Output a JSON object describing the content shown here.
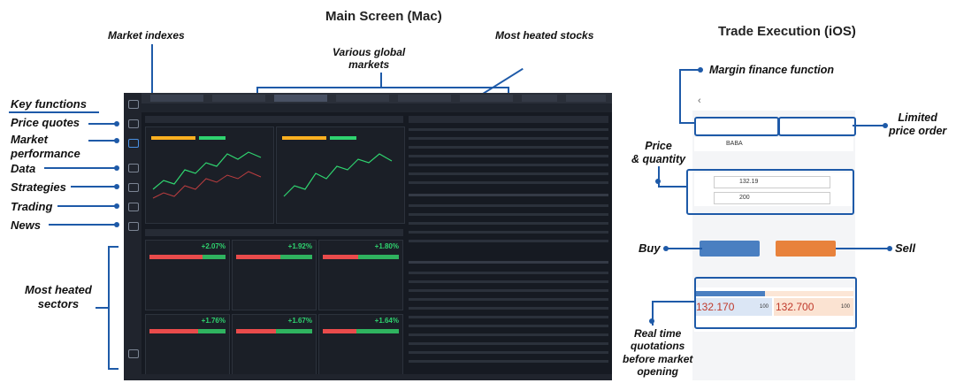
{
  "titles": {
    "main": "Main Screen (Mac)",
    "trade": "Trade Execution (iOS)"
  },
  "labels": {
    "market_indexes": "Market indexes",
    "global_markets": "Various global\nmarkets",
    "heated_stocks": "Most heated stocks",
    "key_functions": "Key functions",
    "price_quotes": "Price quotes",
    "market_performance": "Market\nperformance",
    "data": "Data",
    "strategies": "Strategies",
    "trading": "Trading",
    "news": "News",
    "heated_sectors": "Most heated\nsectors",
    "margin_finance": "Margin finance function",
    "limited_price": "Limited\nprice order",
    "price_quantity": "Price\n& quantity",
    "buy": "Buy",
    "sell": "Sell",
    "realtime": "Real time\nquotations\nbefore market\nopening"
  },
  "mac": {
    "sectors": [
      {
        "pct": "+2.07%"
      },
      {
        "pct": "+1.92%"
      },
      {
        "pct": "+1.80%"
      },
      {
        "pct": "+1.76%"
      },
      {
        "pct": "+1.67%"
      },
      {
        "pct": "+1.64%"
      }
    ]
  },
  "ios": {
    "code": "BABA",
    "price": "132.19",
    "quantity": "200",
    "bid": "132.170",
    "ask": "132.700",
    "bid_size": "100",
    "ask_size": "100"
  },
  "colors": {
    "accent": "#1e5aa8",
    "buy": "#4a7fc1",
    "sell": "#e8823c",
    "gain": "#2fd36f"
  }
}
